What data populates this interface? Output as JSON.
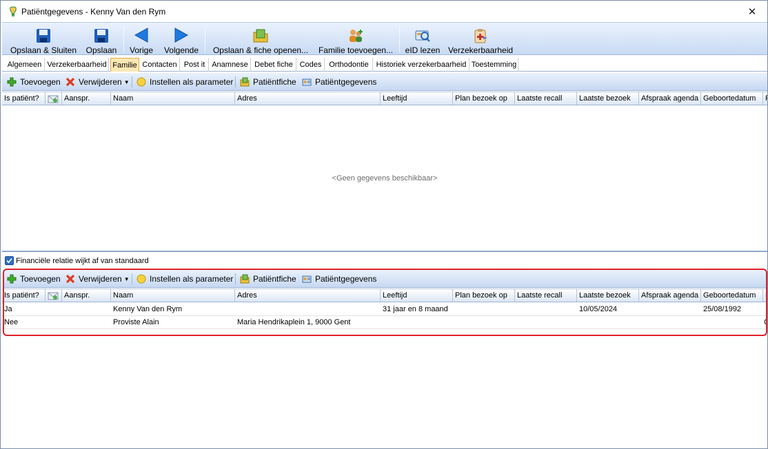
{
  "window": {
    "title": "Patiëntgegevens - Kenny Van den Rym",
    "close_glyph": "✕"
  },
  "toolbar": {
    "save_close": "Opslaan & Sluiten",
    "save": "Opslaan",
    "previous": "Vorige",
    "next": "Volgende",
    "save_open_fiche": "Opslaan & fiche openen...",
    "add_family": "Familie toevoegen...",
    "eid_read": "eID lezen",
    "insurance": "Verzekerbaarheid"
  },
  "tabs": [
    {
      "label": "Algemeen"
    },
    {
      "label": "Verzekerbaarheid"
    },
    {
      "label": "Familie"
    },
    {
      "label": "Contacten"
    },
    {
      "label": "Post it"
    },
    {
      "label": "Anamnese"
    },
    {
      "label": "Debet fiche"
    },
    {
      "label": "Codes"
    },
    {
      "label": "Orthodontie"
    },
    {
      "label": "Historiek verzekerbaarheid"
    },
    {
      "label": "Toestemming"
    }
  ],
  "subtoolbar": {
    "add": "Toevoegen",
    "remove": "Verwijderen",
    "set_parameter": "Instellen als parameter",
    "patient_fiche": "Patiëntfiche",
    "patient_data": "Patiëntgegevens"
  },
  "columns": [
    "Is patiënt?",
    "",
    "Aanspr.",
    "Naam",
    "Adres",
    "Leeftijd",
    "Plan bezoek op",
    "Laatste recall",
    "Laatste bezoek",
    "Afspraak agenda",
    "Geboortedatum",
    "F"
  ],
  "top_grid": {
    "empty_message": "<Geen gegevens beschikbaar>"
  },
  "financial_checkbox": {
    "label": "Financiële relatie wijkt af van standaard",
    "checked": true
  },
  "bottom_grid": {
    "rows": [
      {
        "is_patient": "Ja",
        "aanspr": "",
        "naam": "Kenny Van den Rym",
        "adres": "",
        "leeftijd": "31 jaar en 8 maand",
        "plan": "",
        "recall": "",
        "laatste_bezoek": "10/05/2024",
        "agenda": "",
        "geboorte": "25/08/1992",
        "f": ""
      },
      {
        "is_patient": "Nee",
        "aanspr": "",
        "naam": "Proviste Alain",
        "adres": "Maria Hendrikaplein 1, 9000 Gent",
        "leeftijd": "",
        "plan": "",
        "recall": "",
        "laatste_bezoek": "",
        "agenda": "",
        "geboorte": "",
        "f": "C"
      }
    ]
  },
  "colors": {
    "highlight": "#e0202a",
    "active_tab": "#fce8b4",
    "toolbar_gradient_top": "#eaf2fd",
    "toolbar_gradient_bottom": "#c8daf3"
  }
}
